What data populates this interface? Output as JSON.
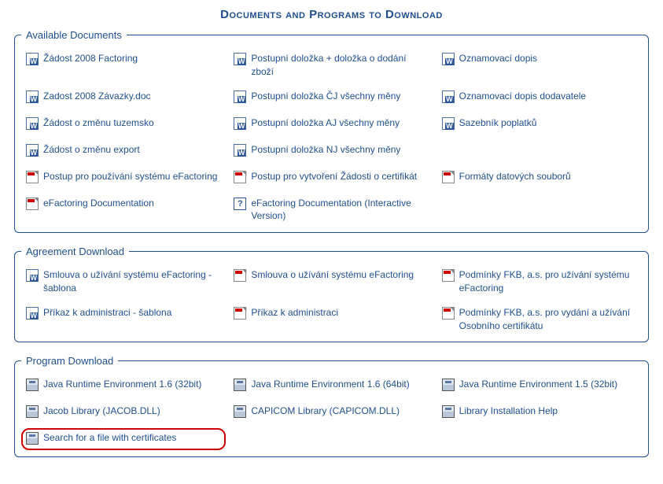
{
  "title": "Documents and Programs to Download",
  "sections": {
    "available": {
      "legend": "Available Documents",
      "items": [
        {
          "icon": "doc",
          "label": "Žádost 2008 Factoring"
        },
        {
          "icon": "doc",
          "label": "Postupní doložka + doložka o dodání zboží"
        },
        {
          "icon": "doc",
          "label": "Oznamovací dopis"
        },
        {
          "icon": "doc",
          "label": "Zadost 2008 Závazky.doc"
        },
        {
          "icon": "doc",
          "label": "Postupní doložka ČJ všechny měny"
        },
        {
          "icon": "doc",
          "label": "Oznamovací dopis dodavatele"
        },
        {
          "icon": "doc",
          "label": "Žádost o změnu tuzemsko"
        },
        {
          "icon": "doc",
          "label": "Postupní doložka AJ všechny měny"
        },
        {
          "icon": "doc",
          "label": "Sazebník poplatků"
        },
        {
          "icon": "doc",
          "label": "Žádost o změnu export"
        },
        {
          "icon": "doc",
          "label": "Postupní doložka NJ všechny měny"
        },
        {
          "icon": "empty",
          "label": ""
        },
        {
          "icon": "pdf",
          "label": "Postup pro používání systému eFactoring"
        },
        {
          "icon": "pdf",
          "label": "Postup pro vytvoření Žádosti o certifikát"
        },
        {
          "icon": "pdf",
          "label": "Formáty datových souborů"
        },
        {
          "icon": "pdf",
          "label": "eFactoring Documentation"
        },
        {
          "icon": "help",
          "label": "eFactoring Documentation (Interactive Version)"
        },
        {
          "icon": "empty",
          "label": ""
        }
      ]
    },
    "agreement": {
      "legend": "Agreement Download",
      "items": [
        {
          "icon": "doc",
          "label": "Smlouva o užívání systému eFactoring - šablona"
        },
        {
          "icon": "pdf",
          "label": "Smlouva o užívání systému eFactoring"
        },
        {
          "icon": "pdf",
          "label": "Podmínky FKB, a.s. pro užívání systému eFactoring"
        },
        {
          "icon": "doc",
          "label": "Příkaz k administraci - šablona"
        },
        {
          "icon": "pdf",
          "label": "Příkaz k administraci"
        },
        {
          "icon": "pdf",
          "label": "Podmínky FKB, a.s. pro vydání a užívání Osobního certifikátu"
        }
      ]
    },
    "program": {
      "legend": "Program Download",
      "items": [
        {
          "icon": "exe",
          "label": "Java Runtime Environment 1.6 (32bit)"
        },
        {
          "icon": "exe",
          "label": "Java Runtime Environment 1.6 (64bit)"
        },
        {
          "icon": "exe",
          "label": "Java Runtime Environment 1.5 (32bit)"
        },
        {
          "icon": "exe",
          "label": "Jacob Library (JACOB.DLL)"
        },
        {
          "icon": "exe",
          "label": "CAPICOM Library (CAPICOM.DLL)"
        },
        {
          "icon": "exe",
          "label": "Library Installation Help"
        },
        {
          "icon": "exe",
          "label": "Search for a file with certificates",
          "highlight": true
        }
      ]
    }
  }
}
